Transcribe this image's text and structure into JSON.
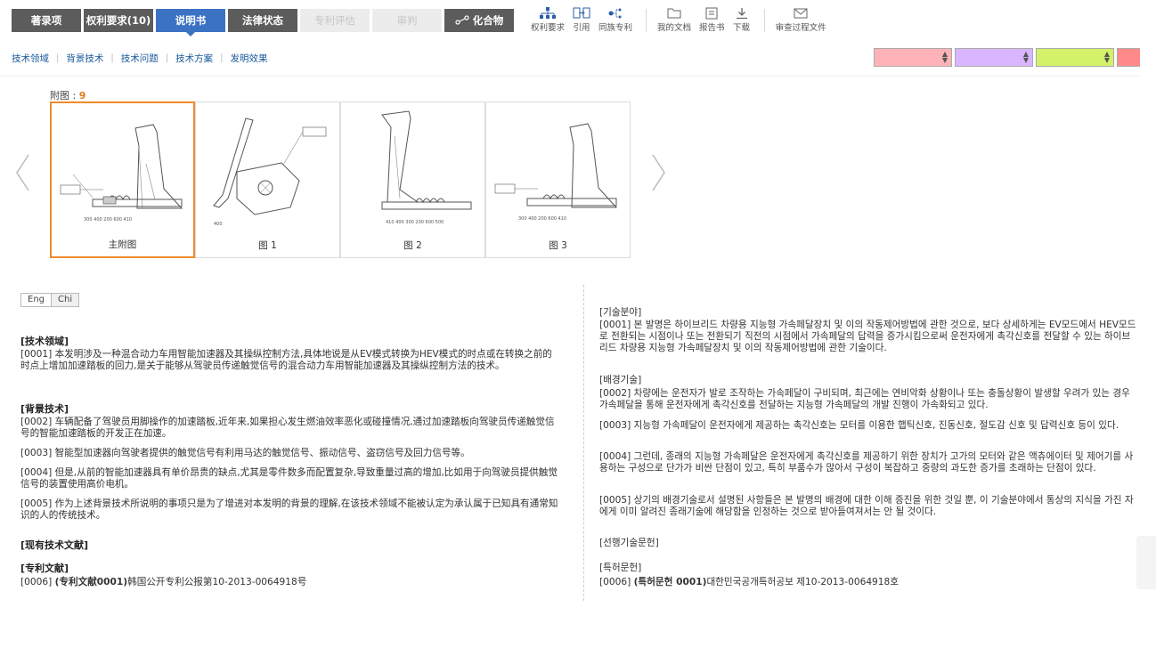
{
  "tabs": [
    {
      "label": "著录项",
      "state": "normal"
    },
    {
      "label": "权利要求(10)",
      "state": "normal"
    },
    {
      "label": "说明书",
      "state": "active"
    },
    {
      "label": "法律状态",
      "state": "normal"
    },
    {
      "label": "专利评估",
      "state": "disabled"
    },
    {
      "label": "审判",
      "state": "disabled"
    },
    {
      "label": "化合物",
      "state": "normal",
      "icon": "chemical-icon"
    }
  ],
  "tools": [
    {
      "label": "权利要求",
      "icon": "hierarchy-icon"
    },
    {
      "label": "引用",
      "icon": "citation-icon"
    },
    {
      "label": "同族专利",
      "icon": "family-icon"
    },
    {
      "label": "我的文档",
      "icon": "folder-icon"
    },
    {
      "label": "报告书",
      "icon": "report-icon"
    },
    {
      "label": "下载",
      "icon": "download-icon"
    },
    {
      "label": "审查过程文件",
      "icon": "mail-icon"
    }
  ],
  "subnav": [
    "技术领域",
    "背景技术",
    "技术问题",
    "技术方案",
    "发明效果"
  ],
  "color_selectors": [
    "#ffb3b8",
    "#d9b6ff",
    "#d3f26a",
    "#ff8a8a"
  ],
  "figures": {
    "title_label": "附图 : ",
    "count": "9",
    "items": [
      {
        "caption": "主附图",
        "selected": true
      },
      {
        "caption": "图 1",
        "selected": false
      },
      {
        "caption": "图 2",
        "selected": false
      },
      {
        "caption": "图 3",
        "selected": false
      }
    ]
  },
  "lang": {
    "eng": "Eng",
    "chi": "Chi",
    "active": "Chi"
  },
  "zh": {
    "h_field": "[技术领域]",
    "p0001": "[0001] 本发明涉及一种混合动力车用智能加速器及其操纵控制方法,具体地说是从EV模式转换为HEV模式的时点或在转换之前的时点上增加加速踏板的回力,是关于能够从驾驶员传递触觉信号的混合动力车用智能加速器及其操纵控制方法的技术。",
    "h_bg": "[背景技术]",
    "p0002": "[0002] 车辆配备了驾驶员用脚操作的加速踏板,近年来,如果担心发生燃油效率恶化或碰撞情况,通过加速踏板向驾驶员传递触觉信号的智能加速踏板的开发正在加速。",
    "p0003": "[0003] 智能型加速器向驾驶者提供的触觉信号有利用马达的触觉信号、振动信号、盗窃信号及回力信号等。",
    "p0004": "[0004] 但是,从前的智能加速器具有单价昂贵的缺点,尤其是零件数多而配置复杂,导致重量过高的增加,比如用于向驾驶员提供触觉信号的装置使用高价电机。",
    "p0005": "[0005] 作为上述背景技术所说明的事项只是为了增进对本发明的背景的理解,在该技术领域不能被认定为承认属于已知具有通常知识的人的传统技术。",
    "h_prior": "[现有技术文献]",
    "h_patent": "[专利文献]",
    "p0006_pre": "[0006] ",
    "p0006_bold": "(专利文献0001)",
    "p0006_post": "韩国公开专利公报第10-2013-0064918号"
  },
  "ko": {
    "h_field": "[기술분야]",
    "p0001": "[0001] 본 발명은 하이브리드 차량용 지능형 가속페달장치 및 이의 작동제어방법에 관한 것으로, 보다 상세하게는 EV모드에서 HEV모드로 전환되는 시점이나 또는 전환되기 직전의 시점에서 가속페달의 답력을 증가시킴으로써 운전자에게 촉각신호를 전달할 수 있는 하이브리드 차량용 지능형 가속페달장치 및 이의 작동제어방법에 관한 기술이다.",
    "h_bg": "[배경기술]",
    "p0002": "[0002] 차량에는 운전자가 발로 조작하는 가속페달이 구비되며, 최근에는 연비악화 상황이나 또는 충돌상황이 발생할 우려가 있는 경우 가속페달을 통해 운전자에게 촉각신호를 전달하는 지능형 가속페달의 개발 진행이 가속화되고 있다.",
    "p0003": "[0003] 지능형 가속페달이 운전자에게 제공하는 촉각신호는 모터를 이용한 햅틱신호, 진동신호, 절도감 신호 및 답력신호 등이 있다.",
    "p0004": "[0004] 그런데, 종래의 지능형 가속페달은 운전자에게 촉각신호를 제공하기 위한 장치가 고가의 모터와 같은 액츄에이터 및 제어기를 사용하는 구성으로 단가가 비싼 단점이 있고, 특히 부품수가 많아서 구성이 복잡하고 중량의 과도한 증가를 초래하는 단점이 있다.",
    "p0005": "[0005] 상기의 배경기술로서 설명된 사항들은 본 발명의 배경에 대한 이해 증진을 위한 것일 뿐, 이 기술분야에서 통상의 지식을 가진 자에게 이미 알려진 종래기술에 해당함을 인정하는 것으로 받아들여져서는 안 될 것이다.",
    "h_prior": "[선행기술문헌]",
    "h_patent": "[특허문헌]",
    "p0006_pre": "[0006] ",
    "p0006_bold": "(특허문헌 0001)",
    "p0006_post": "대한민국공개특허공보 제10-2013-0064918호"
  }
}
